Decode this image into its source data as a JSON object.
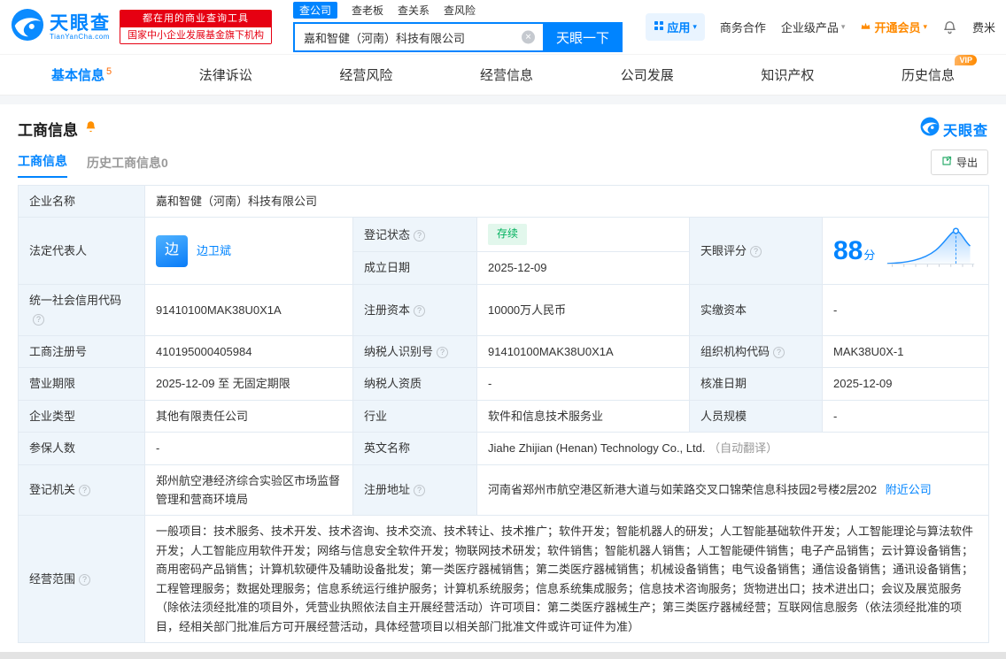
{
  "colors": {
    "accent": "#0084ff",
    "vip_orange": "#ff8a00",
    "badge_red": "#e60012",
    "status_green": "#00b15d"
  },
  "header": {
    "logo_title": "天眼查",
    "logo_domain": "TianYanCha.com",
    "badge_line1": "都在用的商业查询工具",
    "badge_line2": "国家中小企业发展基金旗下机构",
    "search_tabs": [
      {
        "label": "查公司"
      },
      {
        "label": "查老板"
      },
      {
        "label": "查关系"
      },
      {
        "label": "查风险"
      }
    ],
    "search_value": "嘉和智健（河南）科技有限公司",
    "search_button": "天眼一下",
    "nav_apps": "应用",
    "nav_cooperation": "商务合作",
    "nav_enterprise": "企业级产品",
    "nav_vip": "开通会员",
    "nav_user": "费米"
  },
  "tabs": [
    {
      "label": "基本信息",
      "count": "5"
    },
    {
      "label": "法律诉讼"
    },
    {
      "label": "经营风险"
    },
    {
      "label": "经营信息"
    },
    {
      "label": "公司发展"
    },
    {
      "label": "知识产权"
    },
    {
      "label": "历史信息",
      "vip": "VIP"
    }
  ],
  "section": {
    "title": "工商信息",
    "brand": "天眼查",
    "subtab_current": "工商信息",
    "subtab_history": "历史工商信息0",
    "export": "导出"
  },
  "table": {
    "name": {
      "label": "企业名称",
      "value": "嘉和智健（河南）科技有限公司"
    },
    "legal_rep": {
      "label": "法定代表人",
      "avatar": "边",
      "name": "边卫斌"
    },
    "reg_status": {
      "label": "登记状态",
      "value": "存续"
    },
    "establish_date": {
      "label": "成立日期",
      "value": "2025-12-09"
    },
    "score": {
      "label": "天眼评分",
      "value": "88",
      "unit": "分"
    },
    "credit_code": {
      "label": "统一社会信用代码",
      "value": "91410100MAK38U0X1A"
    },
    "reg_capital": {
      "label": "注册资本",
      "value": "10000万人民币"
    },
    "paid_capital": {
      "label": "实缴资本",
      "value": "-"
    },
    "reg_no": {
      "label": "工商注册号",
      "value": "410195000405984"
    },
    "taxpayer_no": {
      "label": "纳税人识别号",
      "value": "91410100MAK38U0X1A"
    },
    "org_code": {
      "label": "组织机构代码",
      "value": "MAK38U0X-1"
    },
    "term": {
      "label": "营业期限",
      "value": "2025-12-09 至 无固定期限"
    },
    "taxpayer_quality": {
      "label": "纳税人资质",
      "value": "-"
    },
    "approval_date": {
      "label": "核准日期",
      "value": "2025-12-09"
    },
    "company_type": {
      "label": "企业类型",
      "value": "其他有限责任公司"
    },
    "industry": {
      "label": "行业",
      "value": "软件和信息技术服务业"
    },
    "staff_size": {
      "label": "人员规模",
      "value": "-"
    },
    "insured_count": {
      "label": "参保人数",
      "value": "-"
    },
    "english_name": {
      "label": "英文名称",
      "value": "Jiahe Zhijian (Henan) Technology Co., Ltd.",
      "note": "（自动翻译）"
    },
    "reg_authority": {
      "label": "登记机关",
      "value": "郑州航空港经济综合实验区市场监督管理和营商环境局"
    },
    "address": {
      "label": "注册地址",
      "value": "河南省郑州市航空港区新港大道与如茉路交叉口锦荣信息科技园2号楼2层202",
      "link": "附近公司"
    },
    "scope": {
      "label": "经营范围",
      "value": "一般项目：技术服务、技术开发、技术咨询、技术交流、技术转让、技术推广；软件开发；智能机器人的研发；人工智能基础软件开发；人工智能理论与算法软件开发；人工智能应用软件开发；网络与信息安全软件开发；物联网技术研发；软件销售；智能机器人销售；人工智能硬件销售；电子产品销售；云计算设备销售；商用密码产品销售；计算机软硬件及辅助设备批发；第一类医疗器械销售；第二类医疗器械销售；机械设备销售；电气设备销售；通信设备销售；通讯设备销售；工程管理服务；数据处理服务；信息系统运行维护服务；计算机系统服务；信息系统集成服务；信息技术咨询服务；货物进出口；技术进出口；会议及展览服务（除依法须经批准的项目外，凭营业执照依法自主开展经营活动）许可项目：第二类医疗器械生产；第三类医疗器械经营；互联网信息服务（依法须经批准的项目，经相关部门批准后方可开展经营活动，具体经营项目以相关部门批准文件或许可证件为准）"
    }
  }
}
